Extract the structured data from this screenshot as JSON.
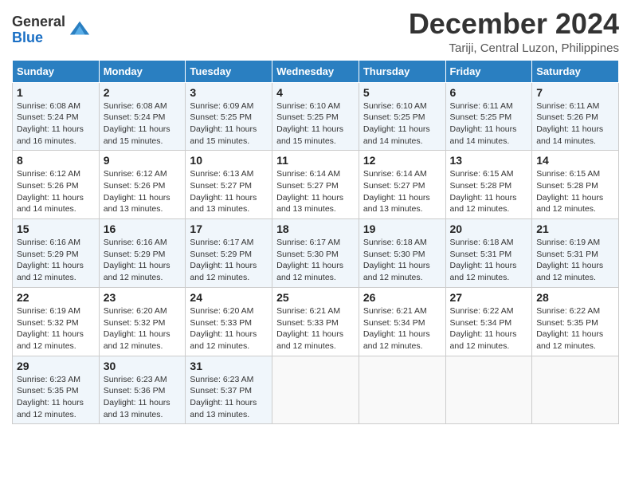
{
  "header": {
    "logo_general": "General",
    "logo_blue": "Blue",
    "month": "December 2024",
    "location": "Tariji, Central Luzon, Philippines"
  },
  "days_of_week": [
    "Sunday",
    "Monday",
    "Tuesday",
    "Wednesday",
    "Thursday",
    "Friday",
    "Saturday"
  ],
  "weeks": [
    [
      {
        "day": "1",
        "sunrise": "Sunrise: 6:08 AM",
        "sunset": "Sunset: 5:24 PM",
        "daylight": "Daylight: 11 hours and 16 minutes."
      },
      {
        "day": "2",
        "sunrise": "Sunrise: 6:08 AM",
        "sunset": "Sunset: 5:24 PM",
        "daylight": "Daylight: 11 hours and 15 minutes."
      },
      {
        "day": "3",
        "sunrise": "Sunrise: 6:09 AM",
        "sunset": "Sunset: 5:25 PM",
        "daylight": "Daylight: 11 hours and 15 minutes."
      },
      {
        "day": "4",
        "sunrise": "Sunrise: 6:10 AM",
        "sunset": "Sunset: 5:25 PM",
        "daylight": "Daylight: 11 hours and 15 minutes."
      },
      {
        "day": "5",
        "sunrise": "Sunrise: 6:10 AM",
        "sunset": "Sunset: 5:25 PM",
        "daylight": "Daylight: 11 hours and 14 minutes."
      },
      {
        "day": "6",
        "sunrise": "Sunrise: 6:11 AM",
        "sunset": "Sunset: 5:25 PM",
        "daylight": "Daylight: 11 hours and 14 minutes."
      },
      {
        "day": "7",
        "sunrise": "Sunrise: 6:11 AM",
        "sunset": "Sunset: 5:26 PM",
        "daylight": "Daylight: 11 hours and 14 minutes."
      }
    ],
    [
      {
        "day": "8",
        "sunrise": "Sunrise: 6:12 AM",
        "sunset": "Sunset: 5:26 PM",
        "daylight": "Daylight: 11 hours and 14 minutes."
      },
      {
        "day": "9",
        "sunrise": "Sunrise: 6:12 AM",
        "sunset": "Sunset: 5:26 PM",
        "daylight": "Daylight: 11 hours and 13 minutes."
      },
      {
        "day": "10",
        "sunrise": "Sunrise: 6:13 AM",
        "sunset": "Sunset: 5:27 PM",
        "daylight": "Daylight: 11 hours and 13 minutes."
      },
      {
        "day": "11",
        "sunrise": "Sunrise: 6:14 AM",
        "sunset": "Sunset: 5:27 PM",
        "daylight": "Daylight: 11 hours and 13 minutes."
      },
      {
        "day": "12",
        "sunrise": "Sunrise: 6:14 AM",
        "sunset": "Sunset: 5:27 PM",
        "daylight": "Daylight: 11 hours and 13 minutes."
      },
      {
        "day": "13",
        "sunrise": "Sunrise: 6:15 AM",
        "sunset": "Sunset: 5:28 PM",
        "daylight": "Daylight: 11 hours and 12 minutes."
      },
      {
        "day": "14",
        "sunrise": "Sunrise: 6:15 AM",
        "sunset": "Sunset: 5:28 PM",
        "daylight": "Daylight: 11 hours and 12 minutes."
      }
    ],
    [
      {
        "day": "15",
        "sunrise": "Sunrise: 6:16 AM",
        "sunset": "Sunset: 5:29 PM",
        "daylight": "Daylight: 11 hours and 12 minutes."
      },
      {
        "day": "16",
        "sunrise": "Sunrise: 6:16 AM",
        "sunset": "Sunset: 5:29 PM",
        "daylight": "Daylight: 11 hours and 12 minutes."
      },
      {
        "day": "17",
        "sunrise": "Sunrise: 6:17 AM",
        "sunset": "Sunset: 5:29 PM",
        "daylight": "Daylight: 11 hours and 12 minutes."
      },
      {
        "day": "18",
        "sunrise": "Sunrise: 6:17 AM",
        "sunset": "Sunset: 5:30 PM",
        "daylight": "Daylight: 11 hours and 12 minutes."
      },
      {
        "day": "19",
        "sunrise": "Sunrise: 6:18 AM",
        "sunset": "Sunset: 5:30 PM",
        "daylight": "Daylight: 11 hours and 12 minutes."
      },
      {
        "day": "20",
        "sunrise": "Sunrise: 6:18 AM",
        "sunset": "Sunset: 5:31 PM",
        "daylight": "Daylight: 11 hours and 12 minutes."
      },
      {
        "day": "21",
        "sunrise": "Sunrise: 6:19 AM",
        "sunset": "Sunset: 5:31 PM",
        "daylight": "Daylight: 11 hours and 12 minutes."
      }
    ],
    [
      {
        "day": "22",
        "sunrise": "Sunrise: 6:19 AM",
        "sunset": "Sunset: 5:32 PM",
        "daylight": "Daylight: 11 hours and 12 minutes."
      },
      {
        "day": "23",
        "sunrise": "Sunrise: 6:20 AM",
        "sunset": "Sunset: 5:32 PM",
        "daylight": "Daylight: 11 hours and 12 minutes."
      },
      {
        "day": "24",
        "sunrise": "Sunrise: 6:20 AM",
        "sunset": "Sunset: 5:33 PM",
        "daylight": "Daylight: 11 hours and 12 minutes."
      },
      {
        "day": "25",
        "sunrise": "Sunrise: 6:21 AM",
        "sunset": "Sunset: 5:33 PM",
        "daylight": "Daylight: 11 hours and 12 minutes."
      },
      {
        "day": "26",
        "sunrise": "Sunrise: 6:21 AM",
        "sunset": "Sunset: 5:34 PM",
        "daylight": "Daylight: 11 hours and 12 minutes."
      },
      {
        "day": "27",
        "sunrise": "Sunrise: 6:22 AM",
        "sunset": "Sunset: 5:34 PM",
        "daylight": "Daylight: 11 hours and 12 minutes."
      },
      {
        "day": "28",
        "sunrise": "Sunrise: 6:22 AM",
        "sunset": "Sunset: 5:35 PM",
        "daylight": "Daylight: 11 hours and 12 minutes."
      }
    ],
    [
      {
        "day": "29",
        "sunrise": "Sunrise: 6:23 AM",
        "sunset": "Sunset: 5:35 PM",
        "daylight": "Daylight: 11 hours and 12 minutes."
      },
      {
        "day": "30",
        "sunrise": "Sunrise: 6:23 AM",
        "sunset": "Sunset: 5:36 PM",
        "daylight": "Daylight: 11 hours and 13 minutes."
      },
      {
        "day": "31",
        "sunrise": "Sunrise: 6:23 AM",
        "sunset": "Sunset: 5:37 PM",
        "daylight": "Daylight: 11 hours and 13 minutes."
      },
      null,
      null,
      null,
      null
    ]
  ]
}
